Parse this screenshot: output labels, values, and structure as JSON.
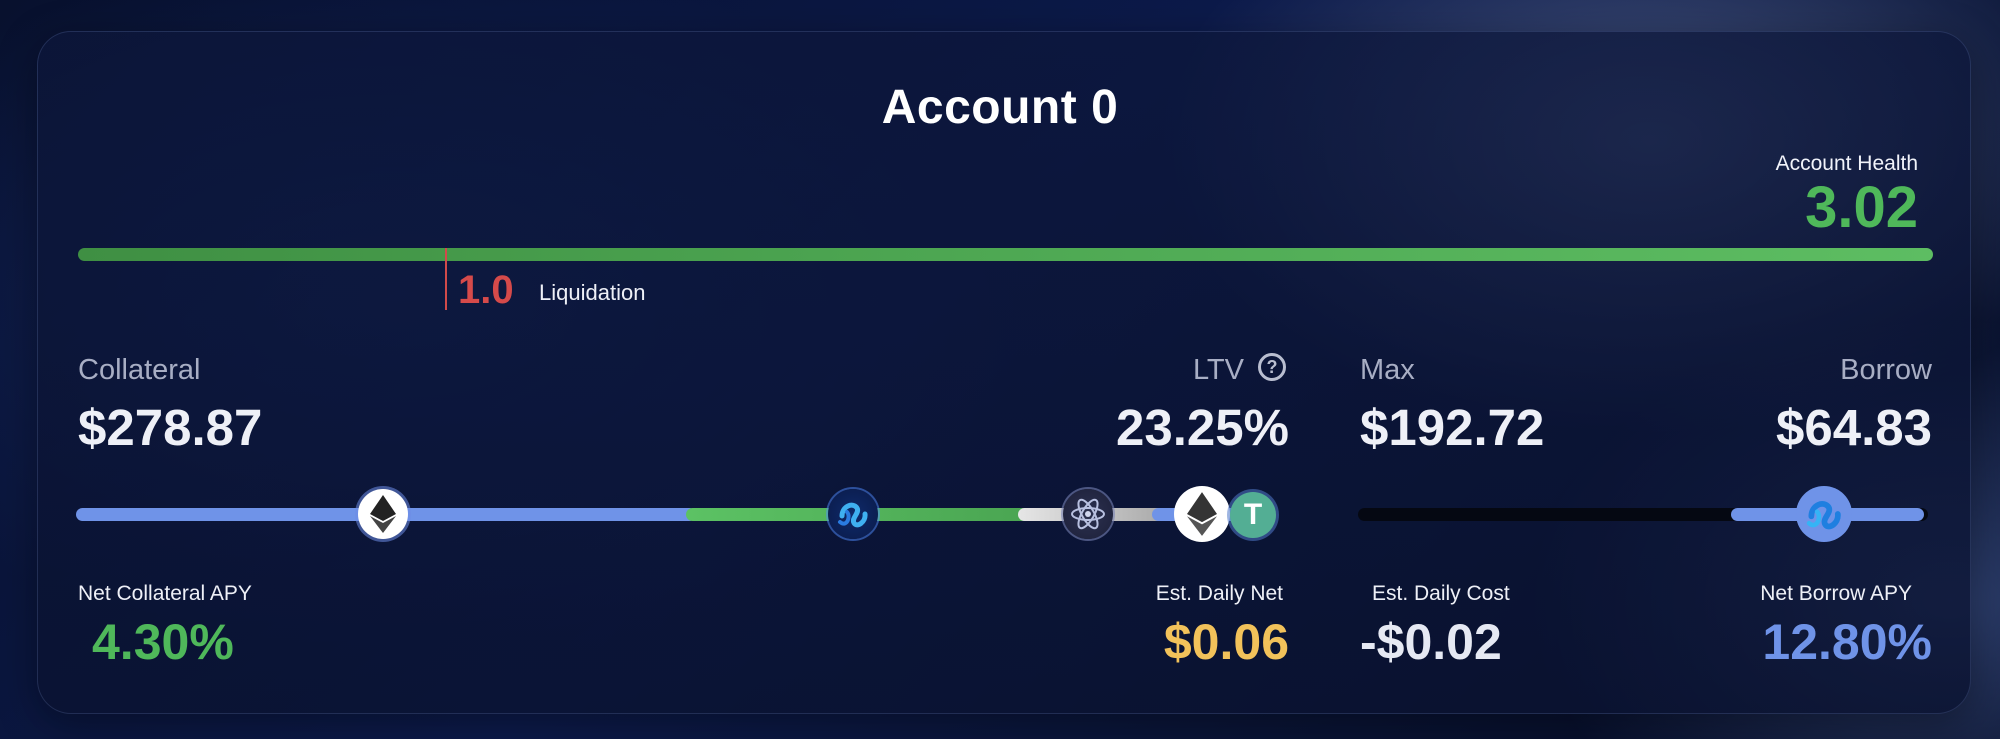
{
  "account": {
    "title": "Account 0",
    "health_label": "Account Health",
    "health_value": "3.02",
    "liquidation_value": "1.0",
    "liquidation_label": "Liquidation"
  },
  "collateral": {
    "label": "Collateral",
    "value": "$278.87",
    "ltv_label": "LTV",
    "ltv_value": "23.25%",
    "net_apy_label": "Net Collateral APY",
    "net_apy_value": "4.30%",
    "daily_net_label": "Est. Daily Net",
    "daily_net_value": "$0.06",
    "tokens": [
      "eth-icon",
      "injective-icon",
      "cosmos-atom-icon",
      "eth-icon",
      "usdt-icon"
    ],
    "usdt_glyph": "T"
  },
  "borrow": {
    "max_label": "Max",
    "max_value": "$192.72",
    "borrow_label": "Borrow",
    "borrow_value": "$64.83",
    "daily_cost_label": "Est. Daily Cost",
    "daily_cost_value": "-$0.02",
    "net_apy_label": "Net Borrow APY",
    "net_apy_value": "12.80%",
    "tokens": [
      "injective-icon"
    ]
  },
  "help_glyph": "?",
  "colors": {
    "health": "#4fb85a",
    "liquidation": "#d54a4a",
    "collateral_apy": "#4fb85a",
    "daily_net": "#f2c25a",
    "borrow_apy": "#6f93e8"
  }
}
